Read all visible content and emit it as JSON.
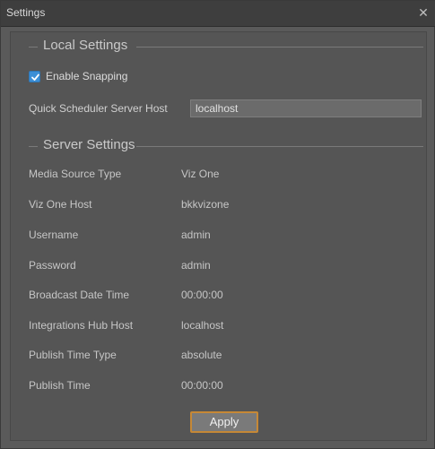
{
  "window": {
    "title": "Settings",
    "close_glyph": "✕",
    "close_icon": "close-icon"
  },
  "local_settings": {
    "header": "Local Settings",
    "enable_snapping": {
      "label": "Enable Snapping",
      "checked": true
    },
    "quick_scheduler": {
      "label": "Quick Scheduler Server Host",
      "value": "localhost"
    }
  },
  "server_settings": {
    "header": "Server Settings",
    "rows": [
      {
        "label": "Media Source Type",
        "value": "Viz One"
      },
      {
        "label": "Viz One Host",
        "value": "bkkvizone"
      },
      {
        "label": "Username",
        "value": "admin"
      },
      {
        "label": "Password",
        "value": "admin"
      },
      {
        "label": "Broadcast Date Time",
        "value": "00:00:00"
      },
      {
        "label": "Integrations Hub Host",
        "value": "localhost"
      },
      {
        "label": "Publish Time Type",
        "value": "absolute"
      },
      {
        "label": "Publish Time",
        "value": "00:00:00"
      }
    ]
  },
  "apply_button": {
    "label": "Apply"
  },
  "colors": {
    "accent": "#3d8fd6",
    "button_border": "#c68836"
  }
}
